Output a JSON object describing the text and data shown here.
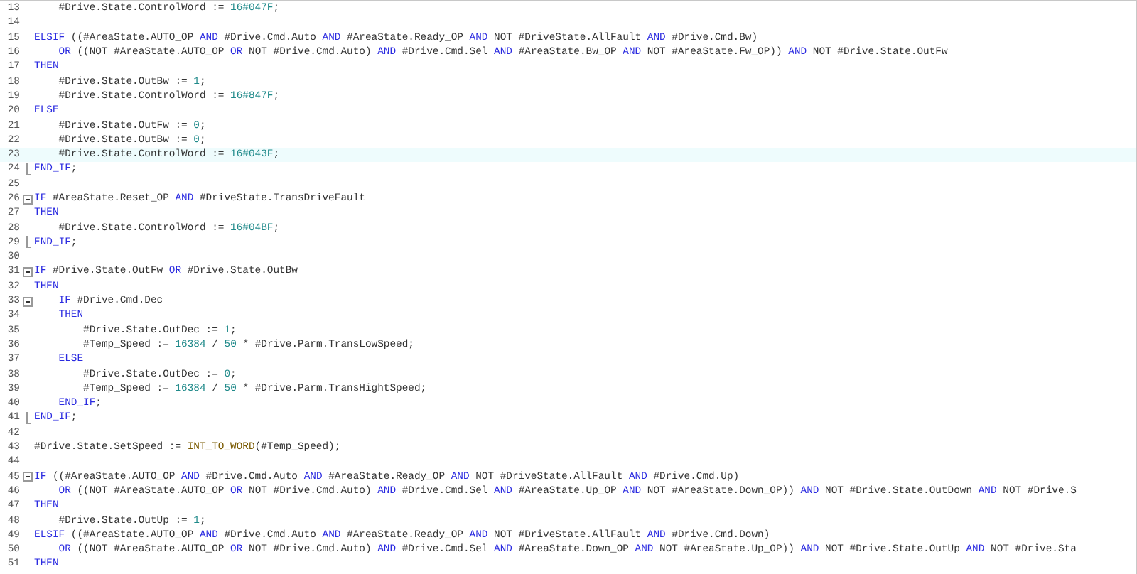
{
  "editor": {
    "lines": [
      {
        "number": "13",
        "tokens": [
          {
            "t": "    #Drive.State.ControlWord := ",
            "kind": "plain"
          },
          {
            "t": "16#047F",
            "kind": "number"
          },
          {
            "t": ";",
            "kind": "plain"
          }
        ]
      },
      {
        "number": "14"
      },
      {
        "number": "15",
        "tokens": [
          {
            "t": "ELSIF",
            "kind": "keyword"
          },
          {
            "t": " ((#AreaState.AUTO_OP ",
            "kind": "plain"
          },
          {
            "t": "AND",
            "kind": "keyword"
          },
          {
            "t": " #Drive.Cmd.Auto ",
            "kind": "plain"
          },
          {
            "t": "AND",
            "kind": "keyword"
          },
          {
            "t": " #AreaState.Ready_OP ",
            "kind": "plain"
          },
          {
            "t": "AND",
            "kind": "keyword"
          },
          {
            "t": " NOT #DriveState.AllFault ",
            "kind": "plain"
          },
          {
            "t": "AND",
            "kind": "keyword"
          },
          {
            "t": " #Drive.Cmd.Bw)",
            "kind": "plain"
          }
        ]
      },
      {
        "number": "16",
        "tokens": [
          {
            "t": "    OR",
            "kind": "keyword"
          },
          {
            "t": " ((NOT #AreaState.AUTO_OP ",
            "kind": "plain"
          },
          {
            "t": "OR",
            "kind": "keyword"
          },
          {
            "t": " NOT #Drive.Cmd.Auto) ",
            "kind": "plain"
          },
          {
            "t": "AND",
            "kind": "keyword"
          },
          {
            "t": " #Drive.Cmd.Sel ",
            "kind": "plain"
          },
          {
            "t": "AND",
            "kind": "keyword"
          },
          {
            "t": " #AreaState.Bw_OP ",
            "kind": "plain"
          },
          {
            "t": "AND",
            "kind": "keyword"
          },
          {
            "t": " NOT #AreaState.Fw_OP)) ",
            "kind": "plain"
          },
          {
            "t": "AND",
            "kind": "keyword"
          },
          {
            "t": " NOT #Drive.State.OutFw",
            "kind": "plain"
          }
        ]
      },
      {
        "number": "17",
        "tokens": [
          {
            "t": "THEN",
            "kind": "keyword"
          }
        ]
      },
      {
        "number": "18",
        "tokens": [
          {
            "t": "    #Drive.State.OutBw := ",
            "kind": "plain"
          },
          {
            "t": "1",
            "kind": "number"
          },
          {
            "t": ";",
            "kind": "plain"
          }
        ]
      },
      {
        "number": "19",
        "tokens": [
          {
            "t": "    #Drive.State.ControlWord := ",
            "kind": "plain"
          },
          {
            "t": "16#847F",
            "kind": "number"
          },
          {
            "t": ";",
            "kind": "plain"
          }
        ]
      },
      {
        "number": "20",
        "tokens": [
          {
            "t": "ELSE",
            "kind": "keyword"
          }
        ]
      },
      {
        "number": "21",
        "tokens": [
          {
            "t": "    #Drive.State.OutFw := ",
            "kind": "plain"
          },
          {
            "t": "0",
            "kind": "number"
          },
          {
            "t": ";",
            "kind": "plain"
          }
        ]
      },
      {
        "number": "22",
        "tokens": [
          {
            "t": "    #Drive.State.OutBw := ",
            "kind": "plain"
          },
          {
            "t": "0",
            "kind": "number"
          },
          {
            "t": ";",
            "kind": "plain"
          }
        ]
      },
      {
        "number": "23",
        "current": true,
        "tokens": [
          {
            "t": "    #Drive.State.ControlWord := ",
            "kind": "plain"
          },
          {
            "t": "16#043F",
            "kind": "number"
          },
          {
            "t": ";",
            "kind": "plain"
          }
        ]
      },
      {
        "number": "24",
        "fold": {
          "kind": "end"
        },
        "tokens": [
          {
            "t": "END_IF",
            "kind": "keyword"
          },
          {
            "t": ";",
            "kind": "plain"
          }
        ]
      },
      {
        "number": "25"
      },
      {
        "number": "26",
        "fold": {
          "kind": "start"
        },
        "tokens": [
          {
            "t": "IF",
            "kind": "keyword"
          },
          {
            "t": " #AreaState.Reset_OP ",
            "kind": "plain"
          },
          {
            "t": "AND",
            "kind": "keyword"
          },
          {
            "t": " #DriveState.TransDriveFault",
            "kind": "plain"
          }
        ]
      },
      {
        "number": "27",
        "tokens": [
          {
            "t": "THEN",
            "kind": "keyword"
          }
        ]
      },
      {
        "number": "28",
        "tokens": [
          {
            "t": "    #Drive.State.ControlWord := ",
            "kind": "plain"
          },
          {
            "t": "16#04BF",
            "kind": "number"
          },
          {
            "t": ";",
            "kind": "plain"
          }
        ]
      },
      {
        "number": "29",
        "fold": {
          "kind": "end"
        },
        "tokens": [
          {
            "t": "END_IF",
            "kind": "keyword"
          },
          {
            "t": ";",
            "kind": "plain"
          }
        ]
      },
      {
        "number": "30"
      },
      {
        "number": "31",
        "fold": {
          "kind": "start"
        },
        "tokens": [
          {
            "t": "IF",
            "kind": "keyword"
          },
          {
            "t": " #Drive.State.OutFw ",
            "kind": "plain"
          },
          {
            "t": "OR",
            "kind": "keyword"
          },
          {
            "t": " #Drive.State.OutBw",
            "kind": "plain"
          }
        ]
      },
      {
        "number": "32",
        "tokens": [
          {
            "t": "THEN",
            "kind": "keyword"
          }
        ]
      },
      {
        "number": "33",
        "fold": {
          "kind": "start"
        },
        "tokens": [
          {
            "t": "    IF",
            "kind": "keyword"
          },
          {
            "t": " #Drive.Cmd.Dec",
            "kind": "plain"
          }
        ]
      },
      {
        "number": "34",
        "tokens": [
          {
            "t": "    THEN",
            "kind": "keyword"
          }
        ]
      },
      {
        "number": "35",
        "tokens": [
          {
            "t": "        #Drive.State.OutDec := ",
            "kind": "plain"
          },
          {
            "t": "1",
            "kind": "number"
          },
          {
            "t": ";",
            "kind": "plain"
          }
        ]
      },
      {
        "number": "36",
        "tokens": [
          {
            "t": "        #Temp_Speed := ",
            "kind": "plain"
          },
          {
            "t": "16384",
            "kind": "number"
          },
          {
            "t": " / ",
            "kind": "plain"
          },
          {
            "t": "50",
            "kind": "number"
          },
          {
            "t": " * #Drive.Parm.TransLowSpeed;",
            "kind": "plain"
          }
        ]
      },
      {
        "number": "37",
        "tokens": [
          {
            "t": "    ELSE",
            "kind": "keyword"
          }
        ]
      },
      {
        "number": "38",
        "tokens": [
          {
            "t": "        #Drive.State.OutDec := ",
            "kind": "plain"
          },
          {
            "t": "0",
            "kind": "number"
          },
          {
            "t": ";",
            "kind": "plain"
          }
        ]
      },
      {
        "number": "39",
        "tokens": [
          {
            "t": "        #Temp_Speed := ",
            "kind": "plain"
          },
          {
            "t": "16384",
            "kind": "number"
          },
          {
            "t": " / ",
            "kind": "plain"
          },
          {
            "t": "50",
            "kind": "number"
          },
          {
            "t": " * #Drive.Parm.TransHightSpeed;",
            "kind": "plain"
          }
        ]
      },
      {
        "number": "40",
        "tokens": [
          {
            "t": "    END_IF",
            "kind": "keyword"
          },
          {
            "t": ";",
            "kind": "plain"
          }
        ]
      },
      {
        "number": "41",
        "fold": {
          "kind": "end"
        },
        "tokens": [
          {
            "t": "END_IF",
            "kind": "keyword"
          },
          {
            "t": ";",
            "kind": "plain"
          }
        ]
      },
      {
        "number": "42"
      },
      {
        "number": "43",
        "tokens": [
          {
            "t": "#Drive.State.SetSpeed := ",
            "kind": "plain"
          },
          {
            "t": "INT_TO_WORD",
            "kind": "function"
          },
          {
            "t": "(#Temp_Speed);",
            "kind": "plain"
          }
        ]
      },
      {
        "number": "44"
      },
      {
        "number": "45",
        "fold": {
          "kind": "start"
        },
        "tokens": [
          {
            "t": "IF",
            "kind": "keyword"
          },
          {
            "t": " ((#AreaState.AUTO_OP ",
            "kind": "plain"
          },
          {
            "t": "AND",
            "kind": "keyword"
          },
          {
            "t": " #Drive.Cmd.Auto ",
            "kind": "plain"
          },
          {
            "t": "AND",
            "kind": "keyword"
          },
          {
            "t": " #AreaState.Ready_OP ",
            "kind": "plain"
          },
          {
            "t": "AND",
            "kind": "keyword"
          },
          {
            "t": " NOT #DriveState.AllFault ",
            "kind": "plain"
          },
          {
            "t": "AND",
            "kind": "keyword"
          },
          {
            "t": " #Drive.Cmd.Up)",
            "kind": "plain"
          }
        ]
      },
      {
        "number": "46",
        "tokens": [
          {
            "t": "    OR",
            "kind": "keyword"
          },
          {
            "t": " ((NOT #AreaState.AUTO_OP ",
            "kind": "plain"
          },
          {
            "t": "OR",
            "kind": "keyword"
          },
          {
            "t": " NOT #Drive.Cmd.Auto) ",
            "kind": "plain"
          },
          {
            "t": "AND",
            "kind": "keyword"
          },
          {
            "t": " #Drive.Cmd.Sel ",
            "kind": "plain"
          },
          {
            "t": "AND",
            "kind": "keyword"
          },
          {
            "t": " #AreaState.Up_OP ",
            "kind": "plain"
          },
          {
            "t": "AND",
            "kind": "keyword"
          },
          {
            "t": " NOT #AreaState.Down_OP)) ",
            "kind": "plain"
          },
          {
            "t": "AND",
            "kind": "keyword"
          },
          {
            "t": " NOT #Drive.State.OutDown ",
            "kind": "plain"
          },
          {
            "t": "AND",
            "kind": "keyword"
          },
          {
            "t": " NOT #Drive.S",
            "kind": "plain"
          }
        ]
      },
      {
        "number": "47",
        "tokens": [
          {
            "t": "THEN",
            "kind": "keyword"
          }
        ]
      },
      {
        "number": "48",
        "tokens": [
          {
            "t": "    #Drive.State.OutUp := ",
            "kind": "plain"
          },
          {
            "t": "1",
            "kind": "number"
          },
          {
            "t": ";",
            "kind": "plain"
          }
        ]
      },
      {
        "number": "49",
        "tokens": [
          {
            "t": "ELSIF",
            "kind": "keyword"
          },
          {
            "t": " ((#AreaState.AUTO_OP ",
            "kind": "plain"
          },
          {
            "t": "AND",
            "kind": "keyword"
          },
          {
            "t": " #Drive.Cmd.Auto ",
            "kind": "plain"
          },
          {
            "t": "AND",
            "kind": "keyword"
          },
          {
            "t": " #AreaState.Ready_OP ",
            "kind": "plain"
          },
          {
            "t": "AND",
            "kind": "keyword"
          },
          {
            "t": " NOT #DriveState.AllFault ",
            "kind": "plain"
          },
          {
            "t": "AND",
            "kind": "keyword"
          },
          {
            "t": " #Drive.Cmd.Down)",
            "kind": "plain"
          }
        ]
      },
      {
        "number": "50",
        "tokens": [
          {
            "t": "    OR",
            "kind": "keyword"
          },
          {
            "t": " ((NOT #AreaState.AUTO_OP ",
            "kind": "plain"
          },
          {
            "t": "OR",
            "kind": "keyword"
          },
          {
            "t": " NOT #Drive.Cmd.Auto) ",
            "kind": "plain"
          },
          {
            "t": "AND",
            "kind": "keyword"
          },
          {
            "t": " #Drive.Cmd.Sel ",
            "kind": "plain"
          },
          {
            "t": "AND",
            "kind": "keyword"
          },
          {
            "t": " #AreaState.Down_OP ",
            "kind": "plain"
          },
          {
            "t": "AND",
            "kind": "keyword"
          },
          {
            "t": " NOT #AreaState.Up_OP)) ",
            "kind": "plain"
          },
          {
            "t": "AND",
            "kind": "keyword"
          },
          {
            "t": " NOT #Drive.State.OutUp ",
            "kind": "plain"
          },
          {
            "t": "AND",
            "kind": "keyword"
          },
          {
            "t": " NOT #Drive.Sta",
            "kind": "plain"
          }
        ]
      },
      {
        "number": "51",
        "tokens": [
          {
            "t": "THEN",
            "kind": "keyword"
          }
        ]
      }
    ]
  }
}
